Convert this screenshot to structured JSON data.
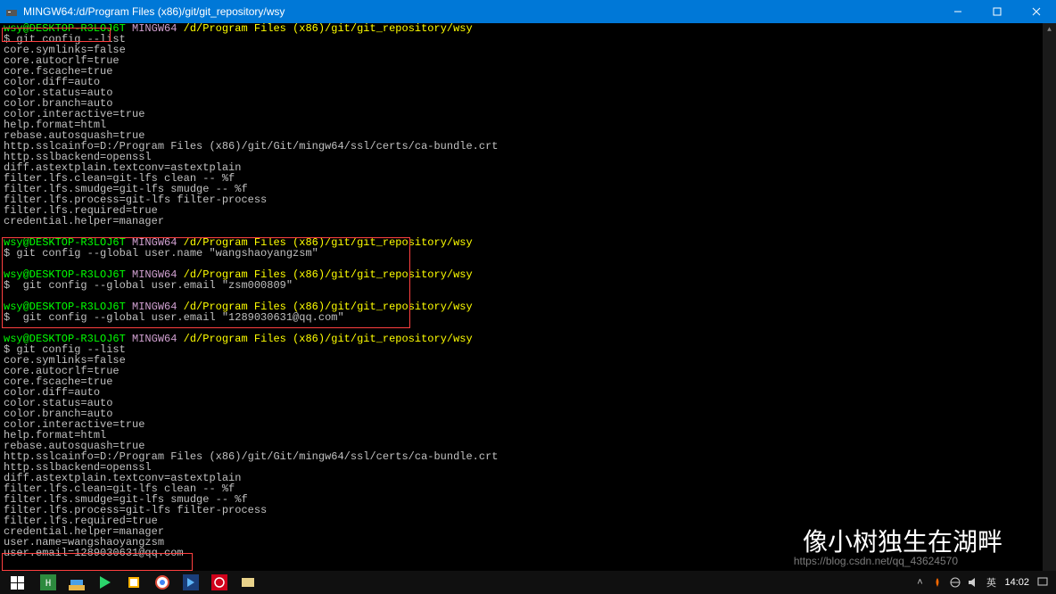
{
  "titlebar": {
    "title": "MINGW64:/d/Program Files (x86)/git/git_repository/wsy"
  },
  "prompt": {
    "user": "wsy@DESKTOP-R3LOJ6T",
    "env": "MINGW64",
    "path": "/d/Program Files (x86)/git/git_repository/wsy",
    "dollar": "$"
  },
  "commands": {
    "cmd1": "git config --list",
    "cmd2": "git config --global user.name \"wangshaoyangzsm\"",
    "cmd3": " git config --global user.email \"zsm000809\"",
    "cmd4": " git config --global user.email \"1289030631@qq.com\"",
    "cmd5": "git config --list"
  },
  "config_output": {
    "l01": "core.symlinks=false",
    "l02": "core.autocrlf=true",
    "l03": "core.fscache=true",
    "l04": "color.diff=auto",
    "l05": "color.status=auto",
    "l06": "color.branch=auto",
    "l07": "color.interactive=true",
    "l08": "help.format=html",
    "l09": "rebase.autosquash=true",
    "l10": "http.sslcainfo=D:/Program Files (x86)/git/Git/mingw64/ssl/certs/ca-bundle.crt",
    "l11": "http.sslbackend=openssl",
    "l12": "diff.astextplain.textconv=astextplain",
    "l13": "filter.lfs.clean=git-lfs clean -- %f",
    "l14": "filter.lfs.smudge=git-lfs smudge -- %f",
    "l15": "filter.lfs.process=git-lfs filter-process",
    "l16": "filter.lfs.required=true",
    "l17": "credential.helper=manager",
    "l18": "user.name=wangshaoyangzsm",
    "l19": "user.email=1289030631@qq.com"
  },
  "overlay": "像小树独生在湖畔",
  "watermark": "https://blog.csdn.net/qq_43624570",
  "taskbar": {
    "time": "14:02",
    "ime": "英"
  }
}
